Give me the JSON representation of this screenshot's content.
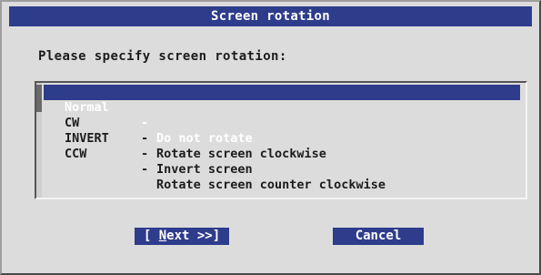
{
  "dialog": {
    "title": "Screen rotation",
    "prompt": "Please specify screen rotation:"
  },
  "options": [
    {
      "key": "Normal",
      "separator": "-",
      "description": "Do not rotate",
      "selected": true
    },
    {
      "key": "CW",
      "separator": "-",
      "description": "Rotate screen clockwise",
      "selected": false
    },
    {
      "key": "INVERT",
      "separator": "-",
      "description": "Invert screen",
      "selected": false
    },
    {
      "key": "CCW",
      "separator": "-",
      "description": "Rotate screen counter clockwise",
      "selected": false
    }
  ],
  "buttons": {
    "next_prefix": "[ ",
    "next_hotkey": "N",
    "next_rest": "ext >>]",
    "cancel_label": "Cancel"
  },
  "colors": {
    "highlight": "#2e3c8c",
    "dialog_bg": "#dcdcdc"
  }
}
